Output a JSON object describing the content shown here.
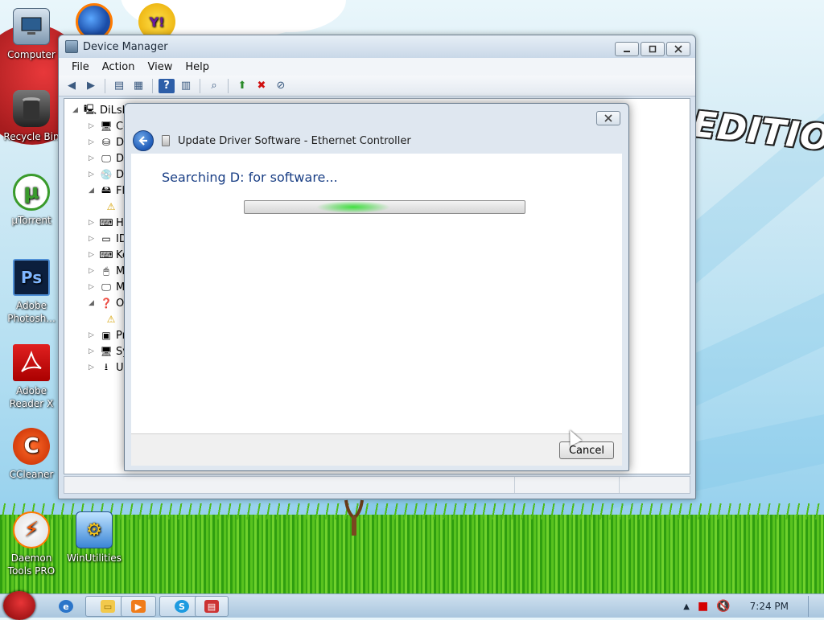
{
  "colors": {
    "accent": "#1a3f85",
    "progress_glow": "#3fe03f",
    "window_frame": "#d7e2ee"
  },
  "desktop": {
    "wallpaper_text": "EDITION",
    "icons": [
      {
        "label": "Computer",
        "icon": "computer-icon"
      },
      {
        "label": "Recycle Bin",
        "icon": "recycle-bin-icon"
      },
      {
        "label": "µTorrent",
        "icon": "utorrent-icon"
      },
      {
        "label": "Adobe Photosh...",
        "icon": "photoshop-icon"
      },
      {
        "label": "Adobe Reader X",
        "icon": "adobe-reader-icon"
      },
      {
        "label": "CCleaner",
        "icon": "ccleaner-icon"
      },
      {
        "label": "Daemon Tools PRO",
        "icon": "daemon-tools-icon"
      },
      {
        "label": "WinUtilities",
        "icon": "winutilities-icon"
      }
    ],
    "top_icons": [
      {
        "icon": "firefox-icon"
      },
      {
        "label": "Y!",
        "icon": "yahoo-messenger-icon"
      }
    ]
  },
  "device_manager": {
    "title": "Device Manager",
    "menu": [
      "File",
      "Action",
      "View",
      "Help"
    ],
    "tree": {
      "root": "DiLsh",
      "items": [
        {
          "label": "Co",
          "expand": "▷"
        },
        {
          "label": "Di",
          "expand": "▷"
        },
        {
          "label": "Di",
          "expand": "▷"
        },
        {
          "label": "DV",
          "expand": "▷"
        },
        {
          "label": "Fl",
          "expand": "◢"
        },
        {
          "label": "",
          "expand": ""
        },
        {
          "label": "Hu",
          "expand": "▷"
        },
        {
          "label": "ID",
          "expand": "▷"
        },
        {
          "label": "Ke",
          "expand": "▷"
        },
        {
          "label": "Mi",
          "expand": "▷"
        },
        {
          "label": "Mo",
          "expand": "▷"
        },
        {
          "label": "Ot",
          "expand": "◢"
        },
        {
          "label": "",
          "expand": ""
        },
        {
          "label": "Pr",
          "expand": "▷"
        },
        {
          "label": "Sy",
          "expand": "▷"
        },
        {
          "label": "Un",
          "expand": "▷"
        }
      ]
    }
  },
  "dialog": {
    "title": "Update Driver Software - Ethernet Controller",
    "status": "Searching D: for software...",
    "cancel_label": "Cancel"
  },
  "taskbar": {
    "clock": "7:24 PM",
    "apps": [
      {
        "icon": "internet-explorer-icon"
      },
      {
        "icon": "explorer-folder-icon"
      },
      {
        "icon": "media-player-icon"
      },
      {
        "icon": "skype-icon"
      },
      {
        "icon": "device-manager-icon"
      }
    ]
  }
}
